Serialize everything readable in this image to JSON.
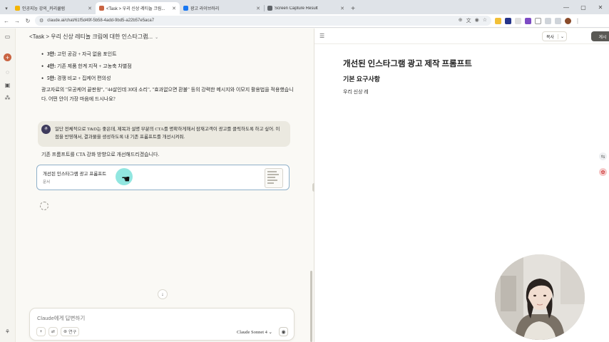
{
  "browser": {
    "tabs": [
      {
        "title": "인공지능 강의_커리큘럼",
        "active": false,
        "color": "#f4b400"
      },
      {
        "title": "<Task > 우리 신상 레티놀 크림...",
        "active": true,
        "color": "#c96442"
      },
      {
        "title": "광고 라이브러리",
        "active": false,
        "color": "#1877f2"
      },
      {
        "title": "Screen Capture Result",
        "active": false,
        "color": "#5f6368"
      }
    ],
    "url": "claude.ai/chat/61f5d49f-5b58-4add-9bd5-a22b57e5aca7"
  },
  "chat": {
    "title": "<Task > 우리 신상 레티놀 크림에 대한 인스타그램...",
    "bullets": [
      {
        "label": "3안:",
        "text": "고민 공감 + 자극 없음 포인트"
      },
      {
        "label": "4안:",
        "text": "기존 제품 한계 지적 + 고농축 차별점"
      },
      {
        "label": "5안:",
        "text": "경쟁 비교 + 집케어 편의성"
      }
    ],
    "paragraph": "광고자료의 \"모공케어 끝판왕\", \"44살인데 30대 소리\", \"효과없으면 환불\" 등의 강력한 메시지와 이모지 활용법을 적용했습니다. 어떤 안이 가장 마음에 드시나요?",
    "user_message": {
      "avatar": "큐",
      "text": "일단 전체적으로 T&D는 좋은데, 제목과 설명 부분의 CTA를 명확하게해서 잠재고객이 광고를 클릭하도록 하고 싶어. 이 점을 반영해서, 결과물을 생성하도록 내 기존 프롬프트를 개선시켜줘."
    },
    "reply": "기존 프롬프트를 CTA 강화 방향으로 개선해드리겠습니다.",
    "artifact_card": {
      "title": "개선된 인스타그램 광고 프롬프트",
      "subtitle": "문서"
    },
    "composer": {
      "placeholder": "Claude에게 답변하기",
      "research_label": "연구",
      "model": "Claude Sonnet 4"
    }
  },
  "panel": {
    "copy_label": "복사",
    "publish_label": "게시",
    "doc_title": "개선된 인스타그램 광고 제작 프롬프트",
    "section_title": "기본 요구사항",
    "body_text": "우리 신상 레"
  }
}
